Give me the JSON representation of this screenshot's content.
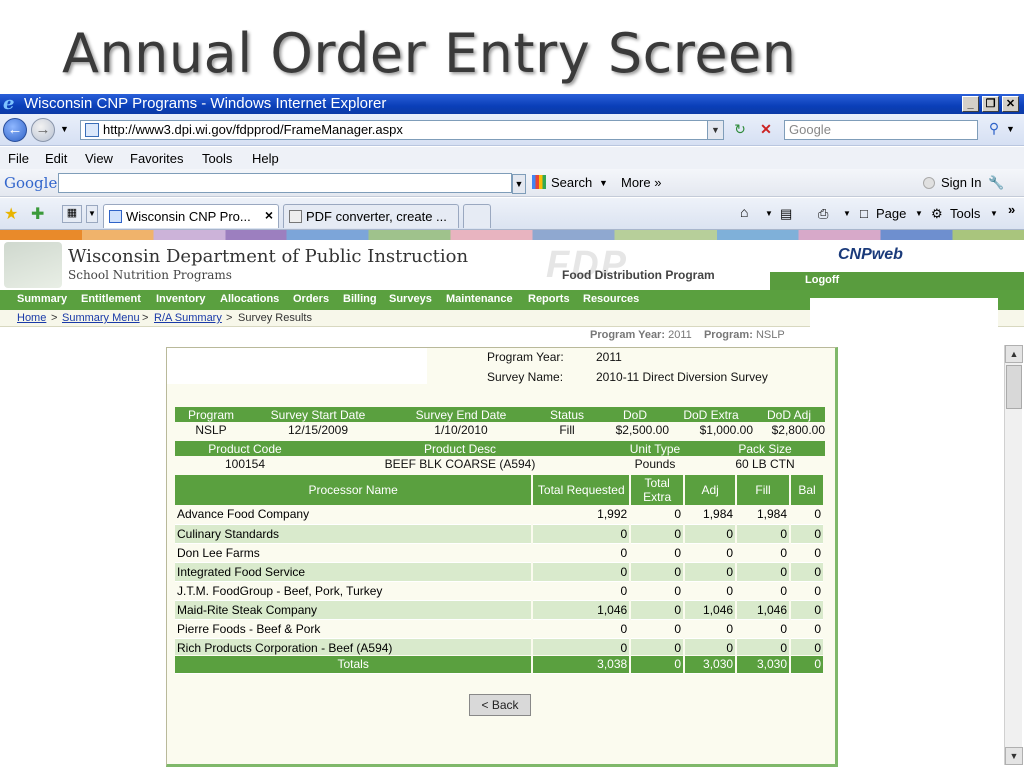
{
  "slide": {
    "title": "Annual Order Entry Screen"
  },
  "window": {
    "title": "Wisconsin CNP Programs - Windows Internet Explorer",
    "min_label": "_",
    "restore_label": "❐",
    "close_label": "✕"
  },
  "address": {
    "url": "http://www3.dpi.wi.gov/fdpprod/FrameManager.aspx",
    "search_placeholder": "Google"
  },
  "menu": [
    "File",
    "Edit",
    "View",
    "Favorites",
    "Tools",
    "Help"
  ],
  "google_toolbar": {
    "logo": "Google",
    "search_label": "Search",
    "more_label": "More »",
    "signin_label": "Sign In"
  },
  "tabs": [
    {
      "label": "Wisconsin CNP Pro...",
      "close": "×"
    },
    {
      "label": "PDF converter, create ..."
    }
  ],
  "commands": {
    "page_label": "Page",
    "tools_label": "Tools"
  },
  "site": {
    "dept": "Wisconsin Department of Public Instruction",
    "sub": "School Nutrition Programs",
    "fdp_big": "FDP",
    "fdp_label": "Food Distribution Program",
    "cnp_logo": "CNPweb",
    "logoff": "Logoff"
  },
  "nav": [
    "Summary",
    "Entitlement",
    "Inventory",
    "Allocations",
    "Orders",
    "Billing",
    "Surveys",
    "Maintenance",
    "Reports",
    "Resources"
  ],
  "breadcrumb": {
    "home": "Home",
    "summary_menu": "Summary Menu",
    "ra_summary": "R/A Summary",
    "current": "Survey Results",
    "sep": ">"
  },
  "program_info": {
    "year_label": "Program Year:",
    "year": "2011",
    "program_label": "Program:",
    "program": "NSLP"
  },
  "survey": {
    "year_label": "Program Year:",
    "year": "2011",
    "name_label": "Survey Name:",
    "name": "2010-11 Direct Diversion Survey"
  },
  "summary_table": {
    "headers": [
      "Program",
      "Survey Start Date",
      "Survey End Date",
      "Status",
      "DoD",
      "DoD Extra",
      "DoD Adj"
    ],
    "row": [
      "NSLP",
      "12/15/2009",
      "1/10/2010",
      "Fill",
      "$2,500.00",
      "$1,000.00",
      "$2,800.00"
    ]
  },
  "product_table": {
    "headers": [
      "Product Code",
      "Product Desc",
      "Unit Type",
      "Pack Size"
    ],
    "row": [
      "100154",
      "BEEF BLK COARSE (A594)",
      "Pounds",
      "60 LB CTN"
    ]
  },
  "processor_table": {
    "headers": [
      "Processor Name",
      "Total Requested",
      "Total Extra",
      "Adj",
      "Fill",
      "Bal"
    ],
    "rows": [
      [
        "Advance Food Company",
        "1,992",
        "0",
        "1,984",
        "1,984",
        "0"
      ],
      [
        "Culinary Standards",
        "0",
        "0",
        "0",
        "0",
        "0"
      ],
      [
        "Don Lee Farms",
        "0",
        "0",
        "0",
        "0",
        "0"
      ],
      [
        "Integrated Food Service",
        "0",
        "0",
        "0",
        "0",
        "0"
      ],
      [
        "J.T.M. FoodGroup - Beef, Pork, Turkey",
        "0",
        "0",
        "0",
        "0",
        "0"
      ],
      [
        "Maid-Rite Steak Company",
        "1,046",
        "0",
        "1,046",
        "1,046",
        "0"
      ],
      [
        "Pierre Foods - Beef & Pork",
        "0",
        "0",
        "0",
        "0",
        "0"
      ],
      [
        "Rich Products Corporation - Beef (A594)",
        "0",
        "0",
        "0",
        "0",
        "0"
      ]
    ],
    "totals": [
      "Totals",
      "3,038",
      "0",
      "3,030",
      "3,030",
      "0"
    ]
  },
  "back_button": "< Back",
  "scroll": {
    "up": "▲",
    "down": "▼"
  }
}
